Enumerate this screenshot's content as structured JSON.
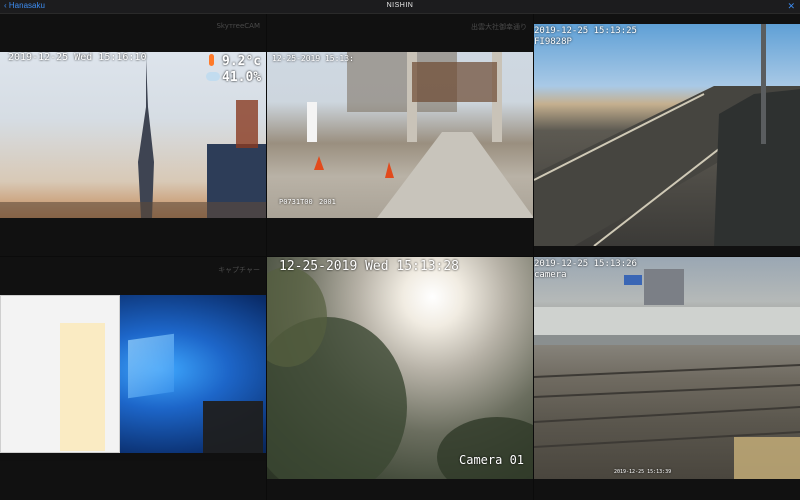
{
  "titlebar": {
    "back_label": "Hanasaku",
    "app_title": "NISHIN",
    "close_label": "✕"
  },
  "cameras": [
    {
      "label": "SkyтreeCAM",
      "timestamp": "2019-12-25 Wed 15:16:10",
      "temperature": "9.2°c",
      "humidity": "41.0%"
    },
    {
      "label": "出雲大社御幸通り",
      "timestamp": "12-25-2019 15:13:",
      "code_left": "P0731T00",
      "code_right": "2001"
    },
    {
      "label": "",
      "timestamp": "2019-12-25 15:13:25",
      "id": "FI9828P"
    },
    {
      "label": "キャプチャー"
    },
    {
      "label": "",
      "timestamp": "12-25-2019 Wed 15:13:28",
      "name": "Camera 01"
    },
    {
      "label": "",
      "timestamp": "2019-12-25 15:13:26",
      "name": "camera",
      "footer_time": "2019-12-25 15:13:39"
    }
  ],
  "icons": {
    "back": "chevron-left-icon",
    "close": "close-icon",
    "thermometer": "thermometer-icon",
    "weather": "cloud-snow-icon"
  }
}
